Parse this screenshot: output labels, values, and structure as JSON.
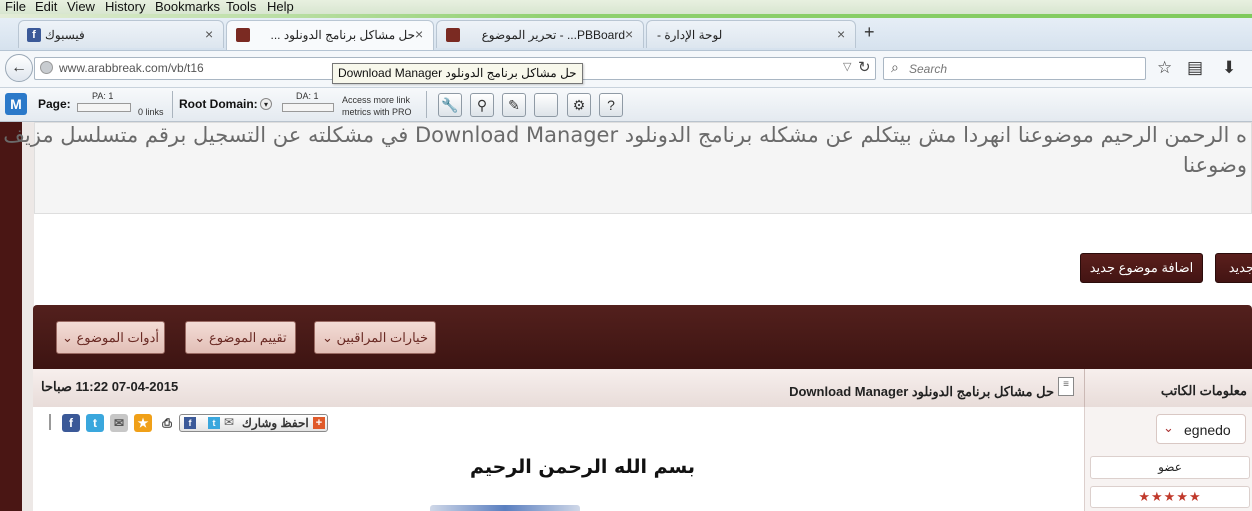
{
  "menu": [
    "File",
    "Edit",
    "View",
    "History",
    "Bookmarks",
    "Tools",
    "Help"
  ],
  "tabs": [
    {
      "title": "فيسبوك",
      "icon": "facebook-icon"
    },
    {
      "title": "حل مشاكل برنامج الدونلود ...",
      "icon": "forum-icon"
    },
    {
      "title": "PBBoard... - تحرير الموضوع",
      "icon": "forum-icon"
    },
    {
      "title": "لوحة الإدارة -",
      "icon": "none"
    }
  ],
  "url": "www.arabbreak.com/vb/t16",
  "tooltip": "Download Manager حل مشاكل برنامج الدونلود",
  "search_placeholder": "Search",
  "seo": {
    "page_label": "Page:",
    "pa": "PA: 1",
    "links": "0 links",
    "root_label": "Root Domain:",
    "da": "DA: 1",
    "access_line1": "Access more link",
    "access_line2": "metrics with PRO"
  },
  "intro": {
    "line1": "ه الرحمن الرحيم موضوعنا انهردا مش بيتكلم عن مشكله برنامج الدونلود Download Manager في مشكلته عن التسجيل برقم متسلسل مزيف",
    "line2": "وضوعنا"
  },
  "buttons": {
    "add_topic": "اضافة موضوع جديد",
    "reply_partial": "جديد"
  },
  "tools": {
    "topic_tools": "أدوات الموضوع",
    "rate_topic": "تقييم الموضوع",
    "mod_options": "خيارات المراقبين"
  },
  "post": {
    "date": "07-04-2015 11:22 صباحا",
    "title": "حل مشاكل برنامج الدونلود Download Manager",
    "share_label": "احفظ وشارك",
    "bismillah": "بسم الله الرحمن الرحيم"
  },
  "author": {
    "header": "معلومات الكاتب",
    "username": "egnedo",
    "rank": "عضو",
    "stars": "★★★★★"
  },
  "colors": {
    "forum_dark": "#4a1614",
    "tool_pink": "#e8c8c0",
    "firefox_blue": "#d6e2ee"
  }
}
